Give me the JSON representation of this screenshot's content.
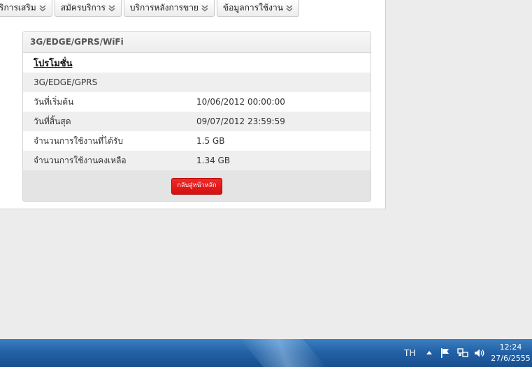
{
  "menu": {
    "items": [
      {
        "label": "ริการเสริม"
      },
      {
        "label": "สมัครบริการ"
      },
      {
        "label": "บริการหลังการขาย"
      },
      {
        "label": "ข้อมูลการใช้งาน"
      }
    ]
  },
  "panel": {
    "header": "3G/EDGE/GPRS/WiFi",
    "promo_title": "โปรโมชั่น",
    "promo_name": "3G/EDGE/GPRS",
    "rows": [
      {
        "label": "วันที่เริ่มต้น",
        "value": "10/06/2012 00:00:00"
      },
      {
        "label": "วันที่สิ้นสุด",
        "value": "09/07/2012 23:59:59"
      },
      {
        "label": "จำนวนการใช้งานที่ได้รับ",
        "value": "1.5 GB"
      },
      {
        "label": "จำนวนการใช้งานคงเหลือ",
        "value": "1.34 GB"
      }
    ],
    "back_button": "กลับสู่หน้าหลัก"
  },
  "taskbar": {
    "language": "TH",
    "time": "12:24",
    "date": "27/6/2555",
    "icons": [
      "show-hidden-icons-arrow",
      "action-center-flag-icon",
      "network-icon",
      "volume-icon"
    ]
  },
  "colors": {
    "button_red": "#e01a1a",
    "taskbar_blue": "#2462a6",
    "panel_grey": "#e4e4e4"
  }
}
